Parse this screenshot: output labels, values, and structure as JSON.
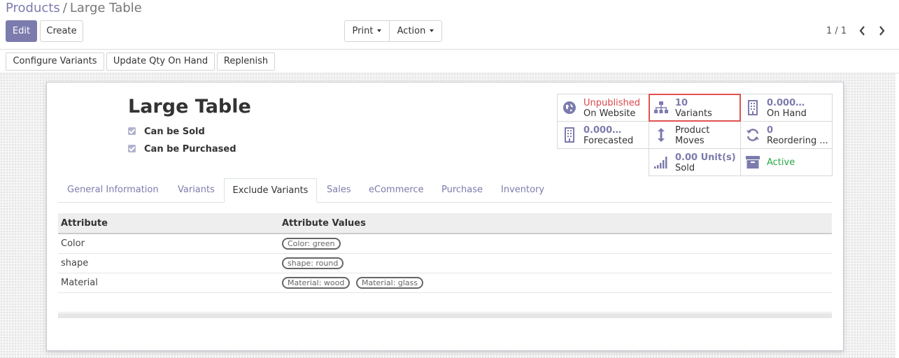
{
  "breadcrumb": {
    "parent": "Products",
    "separator": "/",
    "current": "Large Table"
  },
  "toolbar": {
    "edit": "Edit",
    "create": "Create",
    "print": "Print",
    "action": "Action"
  },
  "pager": {
    "value": "1 / 1"
  },
  "statusbar": {
    "configure_variants": "Configure Variants",
    "update_qty": "Update Qty On Hand",
    "replenish": "Replenish"
  },
  "product": {
    "name": "Large Table",
    "can_be_sold": "Can be Sold",
    "can_be_purchased": "Can be Purchased"
  },
  "smart_buttons": {
    "website": {
      "line1": "Unpublished",
      "line2": "On Website"
    },
    "variants": {
      "value": "10",
      "label": "Variants"
    },
    "on_hand": {
      "value": "0.000…",
      "label": "On Hand"
    },
    "forecasted": {
      "value": "0.000…",
      "label": "Forecasted"
    },
    "moves": {
      "line1": "Product",
      "line2": "Moves"
    },
    "reordering": {
      "value": "0",
      "label": "Reordering ..."
    },
    "sold": {
      "value": "0.00",
      "unit": "Unit(s)",
      "label": "Sold"
    },
    "active": {
      "label": "Active"
    }
  },
  "tabs": [
    "General Information",
    "Variants",
    "Exclude Variants",
    "Sales",
    "eCommerce",
    "Purchase",
    "Inventory"
  ],
  "active_tab": "Exclude Variants",
  "table": {
    "headers": [
      "Attribute",
      "Attribute Values"
    ],
    "rows": [
      {
        "attribute": "Color",
        "values": [
          "Color: green"
        ]
      },
      {
        "attribute": "shape",
        "values": [
          "shape: round"
        ]
      },
      {
        "attribute": "Material",
        "values": [
          "Material: wood",
          "Material: glass"
        ]
      }
    ]
  },
  "colors": {
    "brand": "#7c7bad",
    "danger": "#d9474a",
    "success": "#29a745",
    "highlight_border": "#e0524e"
  }
}
